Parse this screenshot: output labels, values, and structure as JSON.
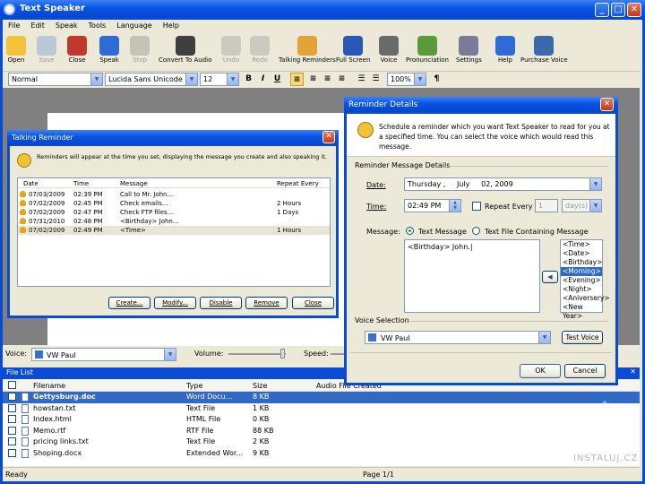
{
  "app": {
    "title": "Text Speaker",
    "menu": [
      "File",
      "Edit",
      "Speak",
      "Tools",
      "Language",
      "Help"
    ],
    "toolbar": [
      {
        "label": "Open",
        "icon": "folder-open-icon",
        "enabled": true
      },
      {
        "label": "Save",
        "icon": "save-icon",
        "enabled": false
      },
      {
        "label": "Close",
        "icon": "close-document-icon",
        "enabled": true
      },
      {
        "label": "Speak",
        "icon": "play-icon",
        "enabled": true
      },
      {
        "label": "Stop",
        "icon": "stop-icon",
        "enabled": false
      },
      {
        "label": "Convert To Audio",
        "icon": "speaker-convert-icon",
        "enabled": true
      },
      {
        "label": "Undo",
        "icon": "undo-icon",
        "enabled": false
      },
      {
        "label": "Redo",
        "icon": "redo-icon",
        "enabled": false
      },
      {
        "label": "Talking Reminders",
        "icon": "reminder-clock-icon",
        "enabled": true
      },
      {
        "label": "Full Screen",
        "icon": "fullscreen-icon",
        "enabled": true
      },
      {
        "label": "Voice",
        "icon": "voice-wand-icon",
        "enabled": true
      },
      {
        "label": "Pronunciation",
        "icon": "pronunciation-icon",
        "enabled": true
      },
      {
        "label": "Settings",
        "icon": "settings-icon",
        "enabled": true
      },
      {
        "label": "Help",
        "icon": "help-icon",
        "enabled": true
      },
      {
        "label": "Purchase Voice",
        "icon": "purchase-voice-icon",
        "enabled": true
      }
    ],
    "format": {
      "style": "Normal",
      "font": "Lucida Sans Unicode",
      "size": "12",
      "zoom": "100%"
    },
    "voicebar": {
      "voice_label": "Voice:",
      "voice": "VW Paul",
      "volume_label": "Volume:",
      "speed_label": "Speed:"
    },
    "file_list": {
      "title": "File List",
      "columns": [
        "Filename",
        "Type",
        "Size",
        "Audio File Created"
      ],
      "rows": [
        {
          "name": "Gettysburg.doc",
          "type": "Word Docu...",
          "size": "8 KB",
          "selected": true
        },
        {
          "name": "howstan.txt",
          "type": "Text File",
          "size": "1 KB"
        },
        {
          "name": "Index.html",
          "type": "HTML File",
          "size": "0 KB"
        },
        {
          "name": "Memo.rtf",
          "type": "RTF File",
          "size": "88 KB"
        },
        {
          "name": "pricing links.txt",
          "type": "Text File",
          "size": "2 KB"
        },
        {
          "name": "Shoping.docx",
          "type": "Extended Wor...",
          "size": "9 KB"
        }
      ]
    },
    "status": {
      "left": "Ready",
      "page": "Page 1/1"
    }
  },
  "talking_reminder": {
    "title": "Talking Reminder",
    "info": "Reminders will appear at the time you set, displaying the message you create and also speaking it.",
    "columns": [
      "Date",
      "Time",
      "Message",
      "Repeat Every"
    ],
    "rows": [
      {
        "date": "07/03/2009",
        "time": "02:39 PM",
        "message": "Call to Mr. John...",
        "repeat": ""
      },
      {
        "date": "07/02/2009",
        "time": "02:45 PM",
        "message": "Check emails...",
        "repeat": "2 Hours"
      },
      {
        "date": "07/02/2009",
        "time": "02:47 PM",
        "message": "Check FTP files...",
        "repeat": "1 Days"
      },
      {
        "date": "07/31/2010",
        "time": "02:48 PM",
        "message": "<Birthday> John...",
        "repeat": ""
      },
      {
        "date": "07/02/2009",
        "time": "02:49 PM",
        "message": "<Time>",
        "repeat": "1 Hours"
      }
    ],
    "buttons": [
      "Create...",
      "Modify...",
      "Disable",
      "Remove",
      "Close"
    ]
  },
  "reminder_details": {
    "title": "Reminder Details",
    "info": "Schedule a reminder which you want Text Speaker to read for you at a specified time. You can select the voice which would read this message.",
    "group_message": "Reminder Message Details",
    "date_label": "Date:",
    "date_value": "Thursday ,     July     02, 2009",
    "time_label": "Time:",
    "time_value": "02:49 PM",
    "repeat_label": "Repeat Every",
    "repeat_value": "1",
    "repeat_unit": "day(s)",
    "message_label": "Message:",
    "opt_text": "Text Message",
    "opt_file": "Text File Containing Message",
    "message_text": "<Birthday> John.",
    "tags": [
      "<Time>",
      "<Date>",
      "<Birthday>",
      "<Morning>",
      "<Evening>",
      "<Night>",
      "<Aniversery>",
      "<New Year>"
    ],
    "selected_tag": 3,
    "group_voice": "Voice Selection",
    "voice": "VW Paul",
    "test_voice": "Test Voice",
    "ok": "OK",
    "cancel": "Cancel"
  },
  "watermark": "INSTALUJ.CZ"
}
